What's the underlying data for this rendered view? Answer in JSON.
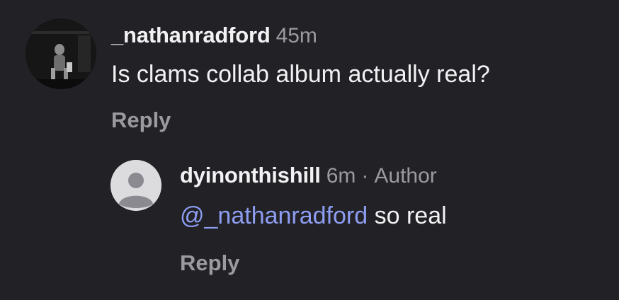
{
  "comment": {
    "username": "_nathanradford",
    "time": "45m",
    "text": "Is clams collab album actually real?",
    "reply_label": "Reply",
    "avatar": "profile-photo"
  },
  "reply": {
    "username": "dyinonthishill",
    "time": "6m",
    "separator": "·",
    "author_tag": "Author",
    "mention": "@_nathanradford",
    "text": "so real",
    "reply_label": "Reply",
    "avatar": "default-user-icon"
  },
  "colors": {
    "background": "#222226",
    "primary_text": "#f2f2f4",
    "secondary_text": "#9a9aa0",
    "mention": "#8d9df2",
    "default_avatar_bg": "#dcdcdf",
    "default_avatar_glyph": "#8a8a90"
  }
}
